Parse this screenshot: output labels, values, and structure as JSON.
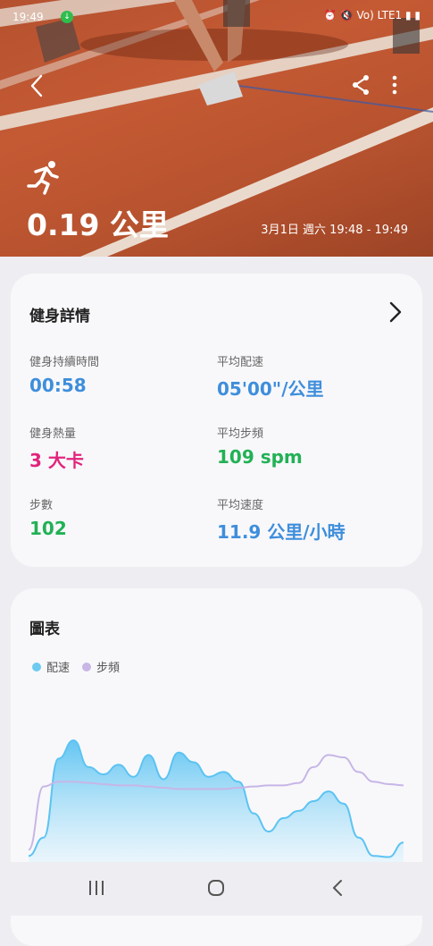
{
  "status": {
    "time": "19:49",
    "right_glyphs": "⏰ 🔇 Vo) LTE1 ▮ ▮"
  },
  "hero": {
    "distance": "0.19 公里",
    "date": "3月1日 週六 19:48 - 19:49"
  },
  "details": {
    "title": "健身詳情",
    "stats": [
      {
        "label": "健身持續時間",
        "value": "00:58",
        "color": "#3f8edb"
      },
      {
        "label": "平均配速",
        "value": "05'00\"/公里",
        "color": "#3f8edb"
      },
      {
        "label": "健身熱量",
        "value": "3 大卡",
        "color": "#e2237c"
      },
      {
        "label": "平均步頻",
        "value": "109 spm",
        "color": "#22b155"
      },
      {
        "label": "步數",
        "value": "102",
        "color": "#22b155"
      },
      {
        "label": "平均速度",
        "value": "11.9 公里/小時",
        "color": "#3f8edb"
      }
    ]
  },
  "chart": {
    "title": "圖表",
    "legend": [
      {
        "label": "配速",
        "color": "#6dcaf0"
      },
      {
        "label": "步頻",
        "color": "#c7b6e6"
      }
    ]
  },
  "chart_data": {
    "type": "area",
    "series": [
      {
        "name": "配速",
        "values": [
          5,
          20,
          85,
          100,
          78,
          72,
          80,
          70,
          88,
          68,
          90,
          82,
          70,
          74,
          66,
          40,
          25,
          36,
          42,
          50,
          58,
          48,
          20,
          5,
          4,
          16
        ]
      },
      {
        "name": "步頻",
        "values": [
          10,
          62,
          66,
          66,
          65,
          64,
          63,
          63,
          62,
          61,
          60,
          60,
          60,
          60,
          61,
          62,
          63,
          63,
          65,
          78,
          88,
          86,
          74,
          66,
          64,
          63
        ]
      }
    ]
  },
  "nav": {
    "recents": "recents-icon",
    "home": "home-icon",
    "back": "back-icon"
  }
}
